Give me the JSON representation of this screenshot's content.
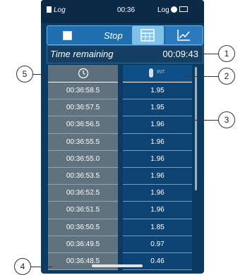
{
  "status_bar": {
    "app_name": "Log",
    "time": "00:36",
    "mode": "Log"
  },
  "toolbar": {
    "stop_label": "Stop"
  },
  "time_remaining": {
    "label": "Time remaining",
    "value": "00:09:43"
  },
  "table": {
    "int_label": "INT",
    "rows": [
      {
        "time": "00:36:58.5",
        "value": "1.95"
      },
      {
        "time": "00:36:57.5",
        "value": "1.95"
      },
      {
        "time": "00:36:56.5",
        "value": "1.96"
      },
      {
        "time": "00:36:55.5",
        "value": "1.96"
      },
      {
        "time": "00:36:55.0",
        "value": "1.96"
      },
      {
        "time": "00:36:53.5",
        "value": "1.96"
      },
      {
        "time": "00:36:52.5",
        "value": "1.96"
      },
      {
        "time": "00:36:51.5",
        "value": "1.96"
      },
      {
        "time": "00:36:50.5",
        "value": "1.85"
      },
      {
        "time": "00:36:49.5",
        "value": "0.97"
      },
      {
        "time": "00:36:48.5",
        "value": "0.46"
      }
    ]
  },
  "callouts": [
    "1",
    "2",
    "3",
    "4",
    "5"
  ],
  "icons": {
    "stop": "stop-square-icon",
    "table_view": "calculator-icon",
    "graph_view": "line-chart-icon",
    "time_column": "clock-icon",
    "int_column": "probe-icon",
    "lock": "lock-icon",
    "battery": "battery-icon"
  },
  "colors": {
    "device_bg": "#0b3a63",
    "toolbar_bg": "#1f6fb0",
    "active_tab": "#7ec2ea"
  }
}
